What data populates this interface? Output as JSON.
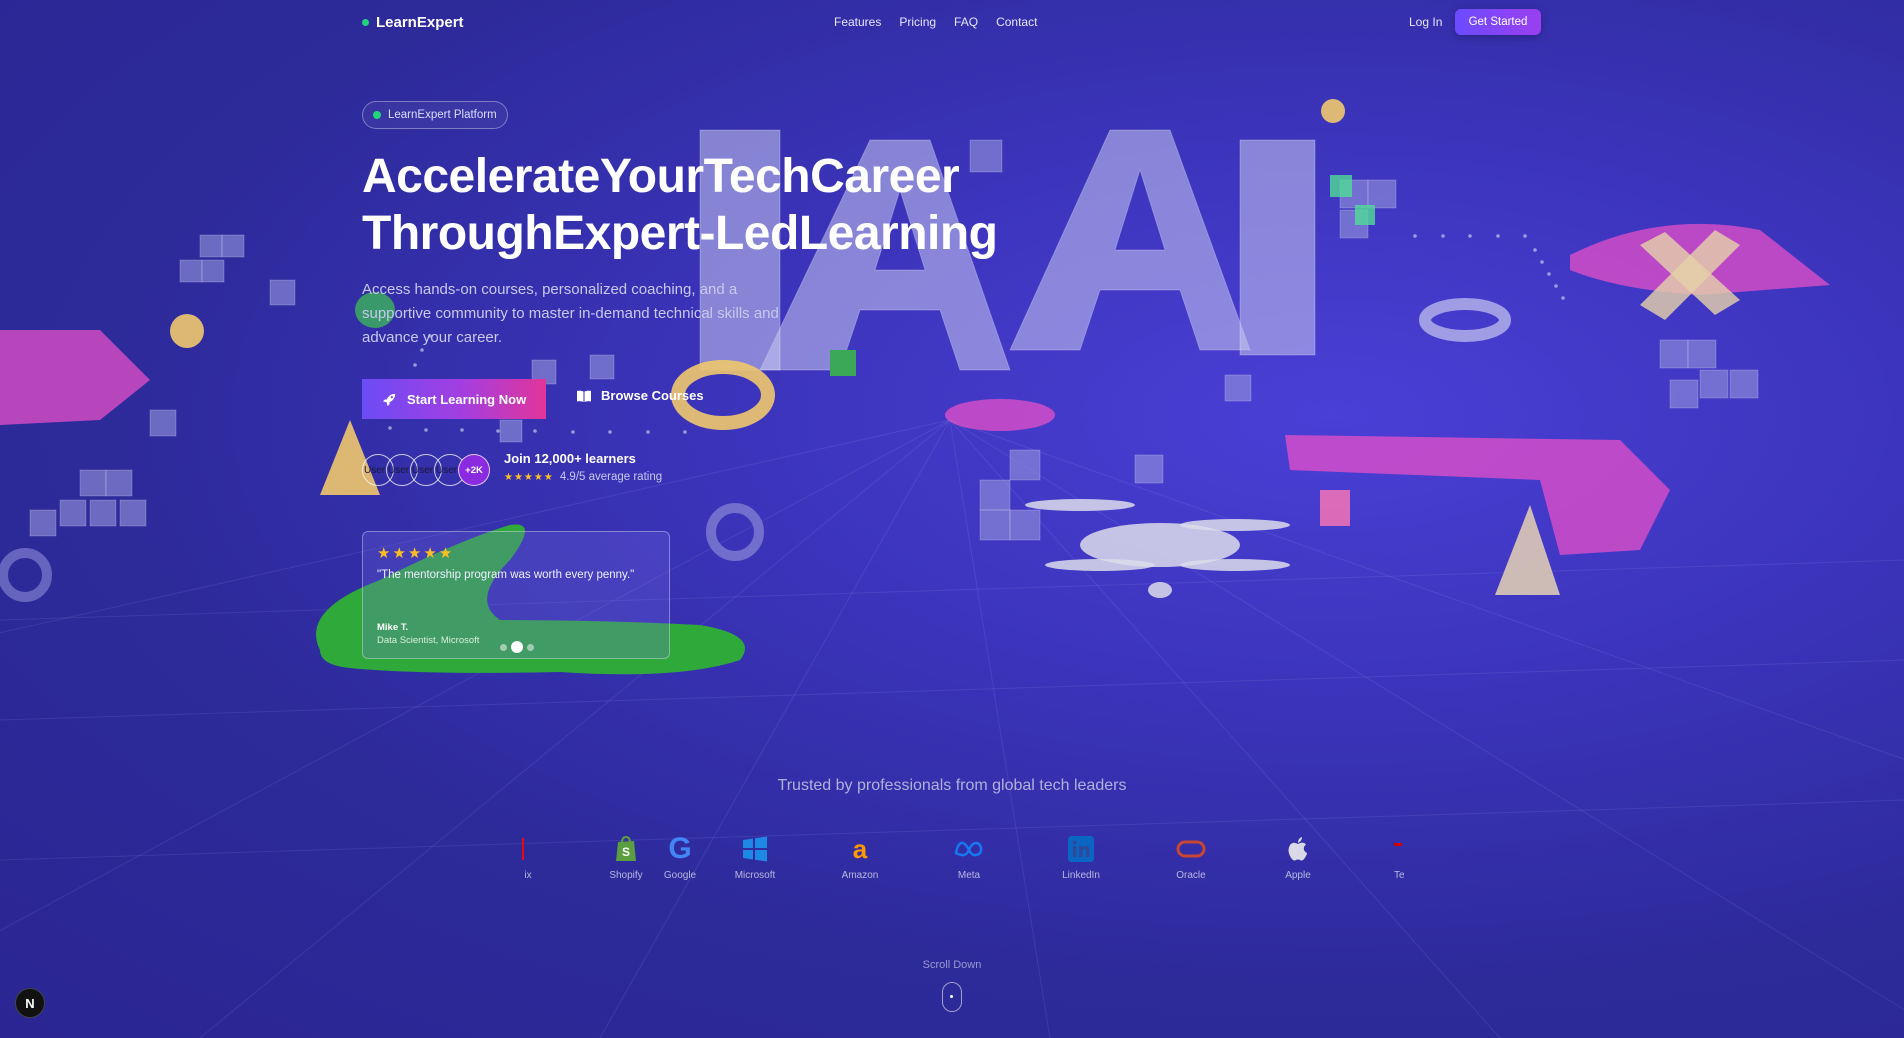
{
  "nav": {
    "logo": "LearnExpert",
    "links": [
      "Features",
      "Pricing",
      "FAQ",
      "Contact"
    ],
    "login": "Log In",
    "cta": "Get Started"
  },
  "hero": {
    "badge": "LearnExpert Platform",
    "title_line1": "AccelerateYourTechCareer",
    "title_line2": "ThroughExpert-LedLearning",
    "description": "Access hands-on courses, personalized coaching, and a supportive community to master in-demand technical skills and advance your career.",
    "primary_button": "Start Learning Now",
    "secondary_button": "Browse Courses",
    "avatars": [
      "User",
      "User",
      "User",
      "User"
    ],
    "avatars_more": "+2K",
    "join_text": "Join 12,000+ learners",
    "rating_stars": "★★★★★",
    "rating_text": "4.9/5 average rating"
  },
  "testimonial": {
    "stars": "★★★★★",
    "quote": "\"The mentorship program was worth every penny.\"",
    "name": "Mike T.",
    "role": "Data Scientist, Microsoft",
    "slide_count": 3,
    "active_slide": 2
  },
  "trusted": {
    "heading": "Trusted by professionals from global tech leaders",
    "companies": [
      {
        "label": "ix",
        "icon": "netflix-icon",
        "color": "#e50914"
      },
      {
        "label": "Shopify",
        "icon": "shopify-icon",
        "color": "#5a9e3f"
      },
      {
        "label": "Google",
        "icon": "google-icon",
        "color": "#4285f4"
      },
      {
        "label": "Microsoft",
        "icon": "microsoft-icon",
        "color": "#1e88e5"
      },
      {
        "label": "Amazon",
        "icon": "amazon-icon",
        "color": "#ff9900"
      },
      {
        "label": "Meta",
        "icon": "meta-icon",
        "color": "#1877f2"
      },
      {
        "label": "LinkedIn",
        "icon": "linkedin-icon",
        "color": "#0a66c2"
      },
      {
        "label": "Oracle",
        "icon": "oracle-icon",
        "color": "#c74634"
      },
      {
        "label": "Apple",
        "icon": "apple-icon",
        "color": "#d8d8e8"
      },
      {
        "label": "Te",
        "icon": "tesla-icon",
        "color": "#cc0000"
      }
    ]
  },
  "scroll": {
    "label": "Scroll Down"
  },
  "dev": {
    "badge": "N"
  }
}
